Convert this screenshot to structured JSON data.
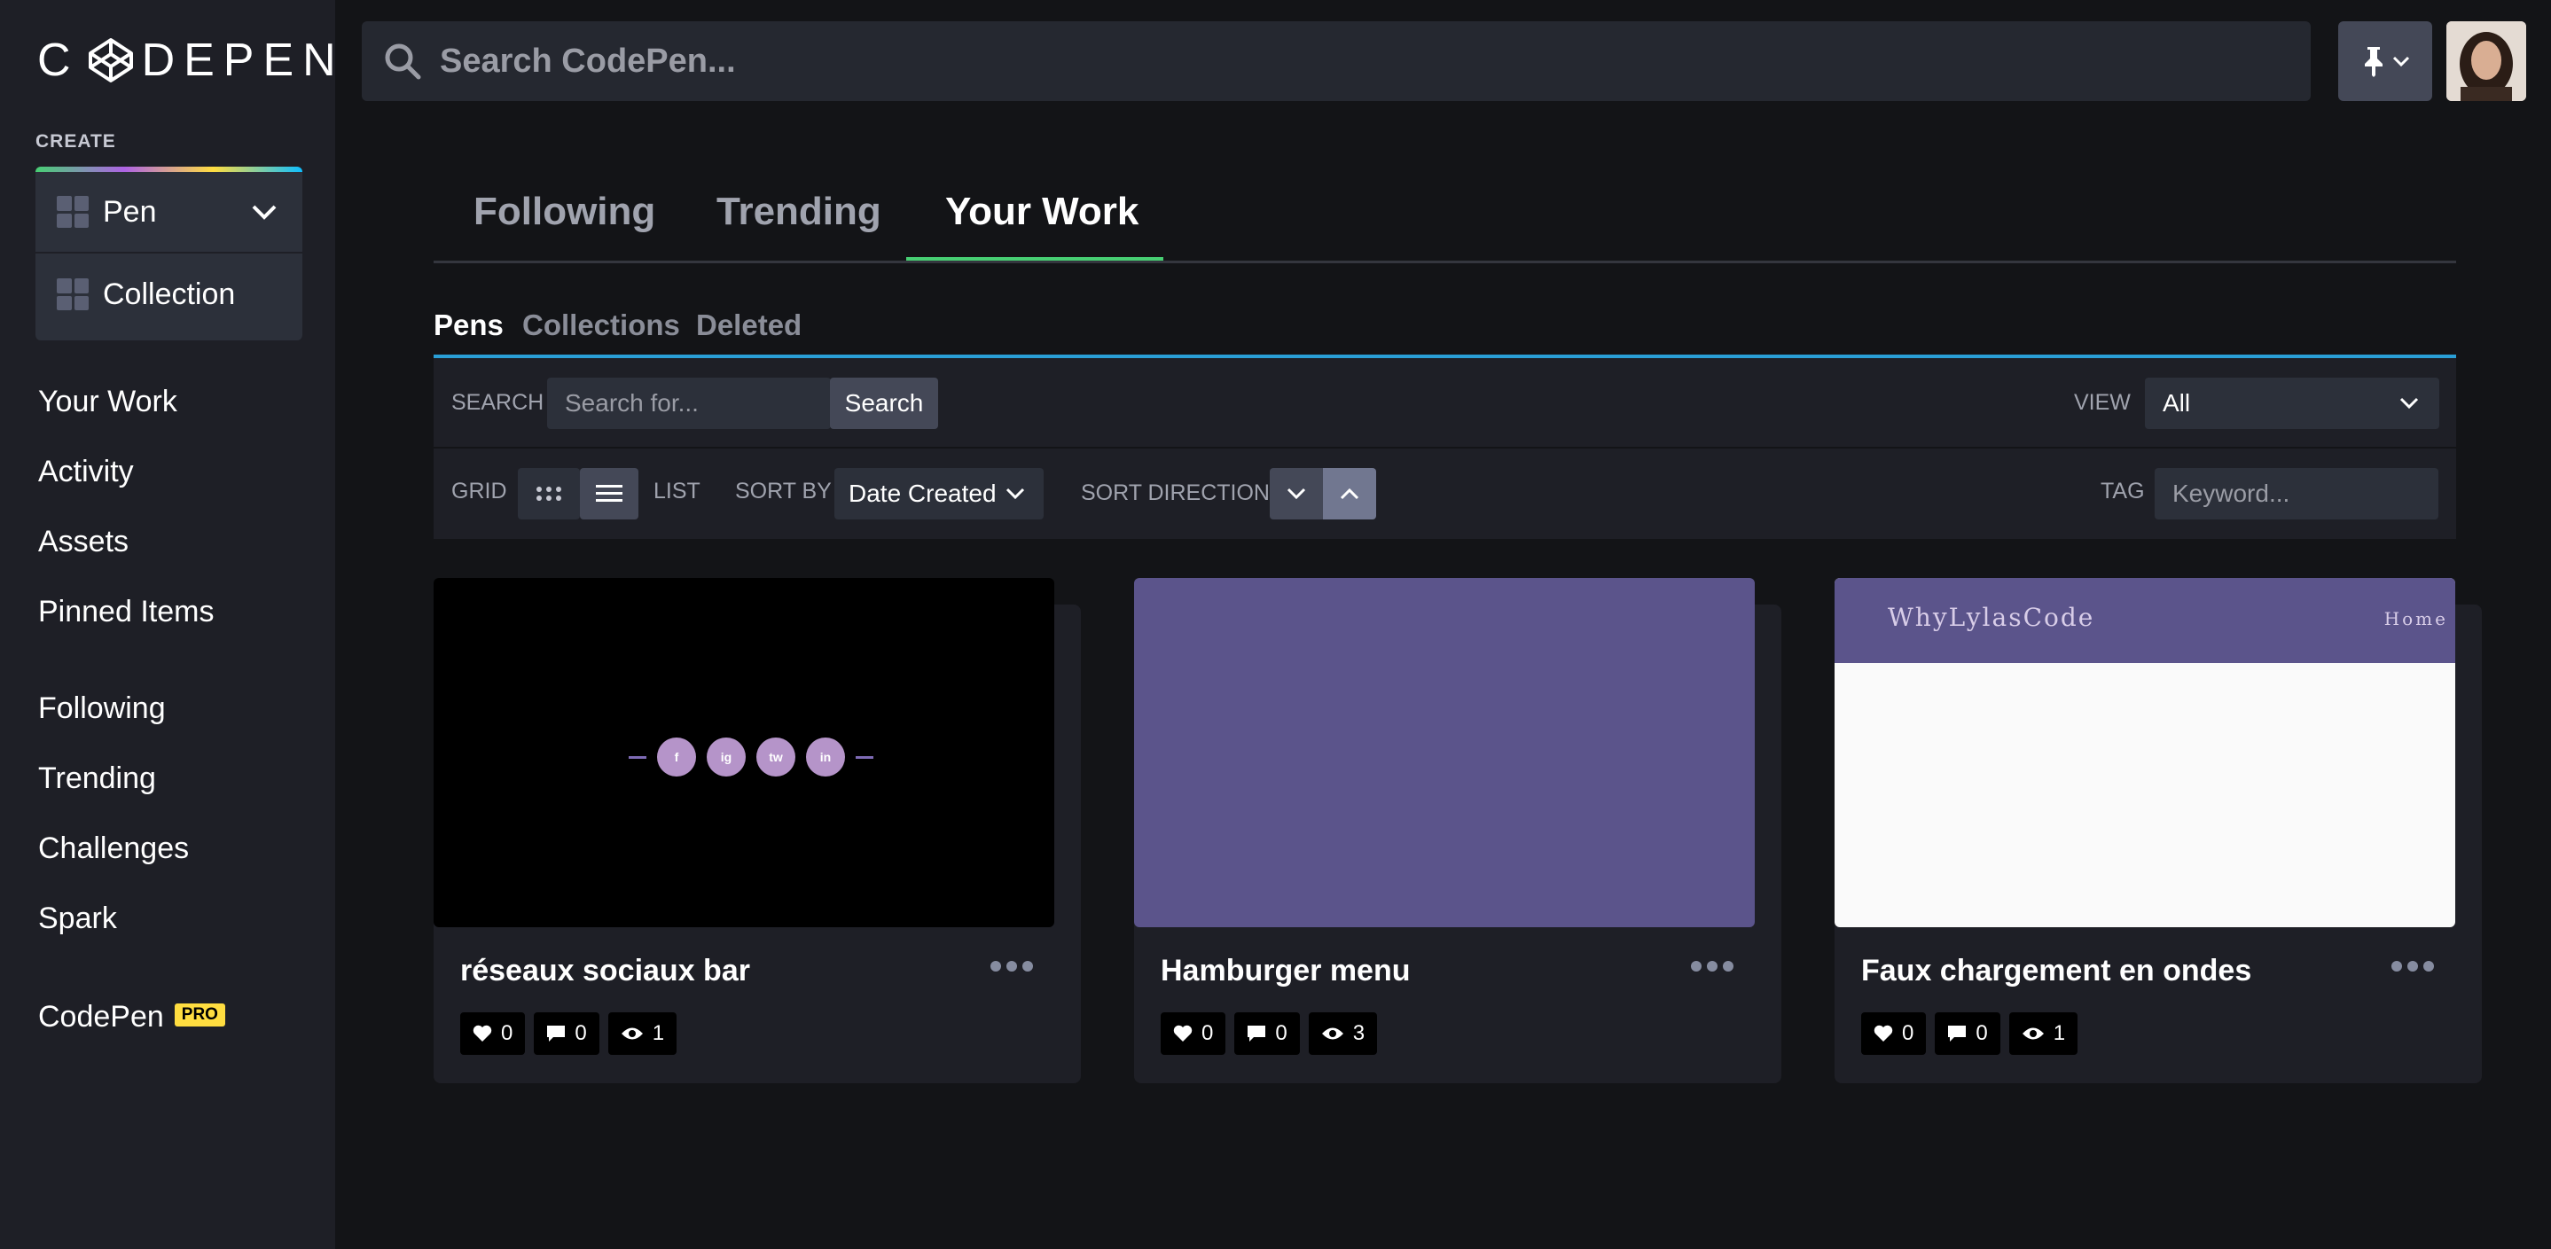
{
  "app": {
    "logo_text": "CODEPEN",
    "search_placeholder": "Search CodePen..."
  },
  "sidebar": {
    "create_label": "CREATE",
    "create_items": [
      {
        "label": "Pen",
        "has_dropdown": true
      },
      {
        "label": "Collection"
      }
    ],
    "nav_group_1": [
      "Your Work",
      "Activity",
      "Assets",
      "Pinned Items"
    ],
    "nav_group_2": [
      "Following",
      "Trending",
      "Challenges",
      "Spark"
    ],
    "pro_link": {
      "label": "CodePen",
      "badge": "PRO"
    }
  },
  "main_tabs": [
    {
      "label": "Following",
      "active": false
    },
    {
      "label": "Trending",
      "active": false
    },
    {
      "label": "Your Work",
      "active": true
    }
  ],
  "sub_tabs": [
    {
      "label": "Pens",
      "active": true
    },
    {
      "label": "Collections",
      "active": false
    },
    {
      "label": "Deleted",
      "active": false
    }
  ],
  "search_bar": {
    "label": "SEARCH",
    "placeholder": "Search for...",
    "button": "Search",
    "view_label": "VIEW",
    "view_value": "All"
  },
  "filter_bar": {
    "grid_label": "GRID",
    "list_label": "LIST",
    "sort_by_label": "SORT BY",
    "sort_by_value": "Date Created",
    "sort_direction_label": "SORT DIRECTION",
    "tag_label": "TAG",
    "tag_placeholder": "Keyword..."
  },
  "pens": [
    {
      "title": "réseaux sociaux bar",
      "likes": "0",
      "comments": "0",
      "views": "1",
      "preview": {
        "background": "#000000",
        "social_icons": [
          "f",
          "ig",
          "tw",
          "in"
        ]
      }
    },
    {
      "title": "Hamburger menu",
      "likes": "0",
      "comments": "0",
      "views": "3",
      "preview": {
        "background": "#5b548b"
      }
    },
    {
      "title": "Faux chargement en ondes",
      "likes": "0",
      "comments": "0",
      "views": "1",
      "preview": {
        "header_background": "#5b548b",
        "body_background": "#fafafa",
        "brand_text": "WhyLylasCode",
        "nav_text": "Home"
      }
    }
  ],
  "colors": {
    "accent_green": "#47cf73",
    "accent_blue": "#2a9fd6",
    "pro_yellow": "#ffdd40"
  }
}
